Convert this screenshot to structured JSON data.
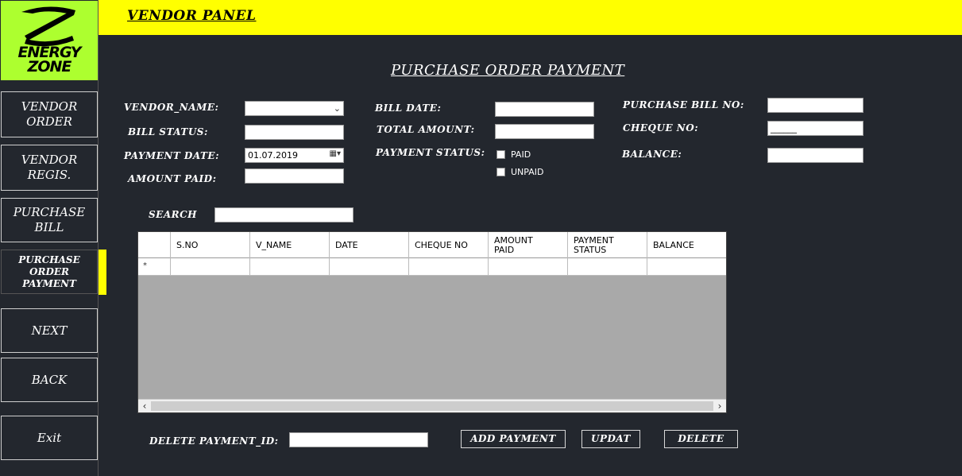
{
  "header": {
    "title": "VENDOR PANEL"
  },
  "logo": {
    "line1": "ENERGY",
    "line2": "ZONE",
    "accent": "#adff2f"
  },
  "sidebar": {
    "items": [
      {
        "line1": "VENDOR",
        "line2": "ORDER"
      },
      {
        "line1": "VENDOR",
        "line2": "REGIS."
      },
      {
        "line1": "PURCHASE",
        "line2": "BILL"
      },
      {
        "line1": "PURCHASE",
        "line2": "ORDER",
        "line3": "PAYMENT"
      }
    ],
    "next": "NEXT",
    "back": "BACK",
    "exit": "Exit"
  },
  "page_title": "PURCHASE ORDER PAYMENT",
  "form": {
    "vendor_name_label": "VENDOR_NAME:",
    "bill_status_label": "BILL STATUS:",
    "payment_date_label": "PAYMENT DATE:",
    "payment_date_value": "01.07.2019",
    "amount_paid_label": "AMOUNT PAID:",
    "bill_date_label": "BILL DATE:",
    "total_amount_label": "TOTAL AMOUNT:",
    "payment_status_label": "PAYMENT STATUS:",
    "paid_label": "PAID",
    "unpaid_label": "UNPAID",
    "purchase_bill_no_label": "PURCHASE BILL NO:",
    "cheque_no_label": "CHEQUE NO:",
    "cheque_no_value": "______",
    "balance_label": "BALANCE:"
  },
  "search": {
    "label": "SEARCH"
  },
  "grid": {
    "columns": [
      "S.NO",
      "V_NAME",
      "DATE",
      "CHEQUE NO",
      "AMOUNT\nPAID",
      "PAYMENT\nSTATUS",
      "BALANCE"
    ],
    "new_row_marker": "*"
  },
  "actions": {
    "delete_id_label": "DELETE PAYMENT_ID:",
    "add": "ADD PAYMENT",
    "update": "UPDAT",
    "delete": "DELETE"
  },
  "colors": {
    "header": "#ffff00",
    "background": "#23272e"
  }
}
